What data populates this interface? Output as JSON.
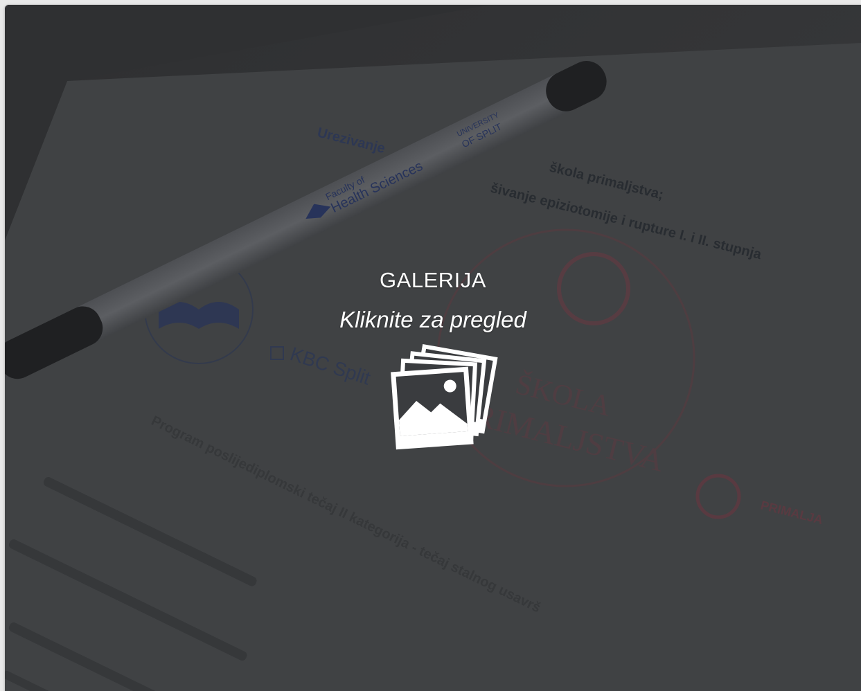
{
  "gallery": {
    "title": "GALERIJA",
    "subtitle": "Kliknite za pregled",
    "icon": "photo-gallery-icon"
  },
  "background_photo": {
    "document_lines": [
      "Urezivanje",
      "škola primaljstva;",
      "šivanje epiziotomije i rupture I. i II. stupnja",
      "Program poslijediplomski tečaj II kategorija - tečaj stalnog usavrš"
    ],
    "pen_text": {
      "faculty": "Faculty of",
      "faculty_name": "Health Sciences",
      "university": "UNIVERSITY",
      "university_name": "OF SPLIT"
    },
    "logo_kbc": "KBC Split",
    "logo_school_line1": "ŠKOLA",
    "logo_school_line2": "PRIMALJSTVA",
    "logo_primalja": "PRIMALJA"
  },
  "colors": {
    "overlay": "#3a3c3f",
    "text": "#ffffff",
    "doc_ink": "#1c2a55",
    "logo_red": "#c0404c"
  }
}
